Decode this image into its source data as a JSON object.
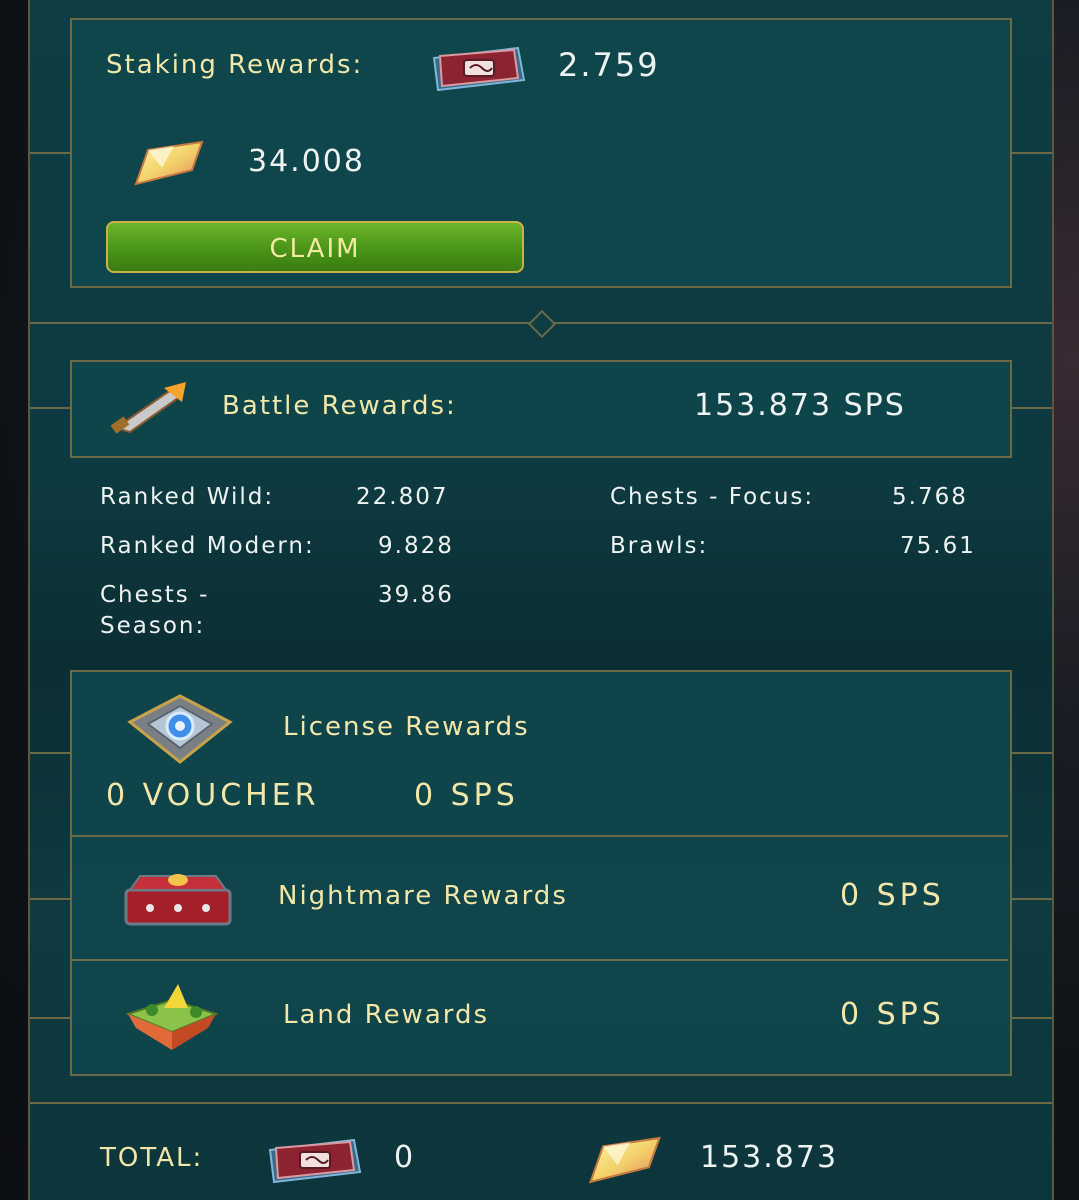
{
  "staking": {
    "label": "Staking Rewards:",
    "voucher_value": "2.759",
    "sps_value": "34.008",
    "claim_label": "CLAIM"
  },
  "battle": {
    "label": "Battle Rewards:",
    "total": "153.873 SPS",
    "breakdown": [
      {
        "label": "Ranked Wild:",
        "value": "22.807"
      },
      {
        "label": "Ranked Modern:",
        "value": "9.828"
      },
      {
        "label_line1": "Chests -",
        "label_line2": "Season:",
        "value": "39.86"
      },
      {
        "label": "Chests - Focus:",
        "value": "5.768"
      },
      {
        "label": "Brawls:",
        "value": "75.61"
      }
    ]
  },
  "license": {
    "label": "License Rewards",
    "voucher": "0 VOUCHER",
    "sps": "0 SPS"
  },
  "nightmare": {
    "label": "Nightmare Rewards",
    "value": "0 SPS"
  },
  "land": {
    "label": "Land Rewards",
    "value": "0 SPS"
  },
  "total": {
    "label": "TOTAL:",
    "voucher_value": "0",
    "sps_value": "153.873"
  },
  "colors": {
    "gold": "#f2e7a8",
    "panel": "#0f3d44",
    "border": "#6b6a45",
    "claim_green": "#4a9418"
  },
  "icons": [
    "voucher-book-icon",
    "sps-crystal-icon",
    "sword-icon",
    "license-badge-icon",
    "nightmare-chest-icon",
    "land-island-icon"
  ]
}
